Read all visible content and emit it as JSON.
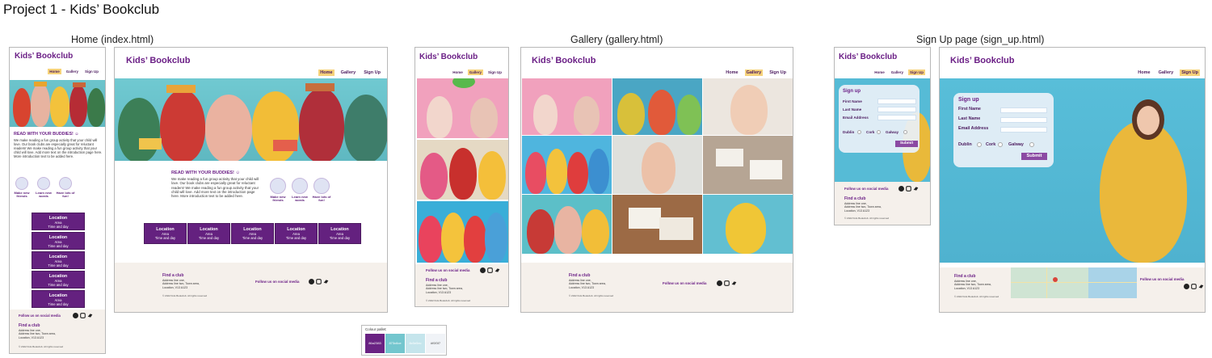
{
  "title": "Project 1 - Kids’ Bookclub",
  "sections": {
    "home": "Home (index.html)",
    "gallery": "Gallery (gallery.html)",
    "signup": "Sign Up page (sign_up.html)"
  },
  "site": {
    "brand": "Kids’ Bookclub",
    "nav": {
      "home": "Home",
      "gallery": "Gallery",
      "signup": "Sign Up"
    }
  },
  "home": {
    "heading": "READ WITH YOUR BUDDIES! ☺",
    "intro": "We make reading a fun group activity that your child will love. Our book clubs are especially great for reluctant readers!  We make reading a fun group activity that your child will love. Add more text on the introduction page here. More introduction text to be added here.",
    "icons": [
      "Make new friends",
      "Learn new words",
      "Have lots of fun!"
    ],
    "location": {
      "title": "Location",
      "area": "Area",
      "time": "Time and day"
    }
  },
  "footer": {
    "find_club": "Find a club",
    "address": [
      "Address line one,",
      "Address line two, Town area,",
      "Location, V13 A123"
    ],
    "copyright": "© 2022 Kids Bookclub. All rights reserved",
    "follow": "Follow us on social media",
    "social_icons": [
      "facebook-icon",
      "instagram-icon",
      "twitter-icon"
    ]
  },
  "signup": {
    "form_title": "Sign up",
    "fields": [
      "First Name",
      "Last Name",
      "Email Address"
    ],
    "radios": [
      "Dublin",
      "Cork",
      "Galway"
    ],
    "submit": "Submit"
  },
  "palette": {
    "label": "Colour pallet:",
    "colors": [
      "#6a2383",
      "#73c6ce",
      "#c5e5ec",
      "#f0f3f7"
    ],
    "swatch_labels": [
      "86a2383",
      "873c6ce",
      "8c5e5ec",
      "#f0f3f7"
    ]
  }
}
